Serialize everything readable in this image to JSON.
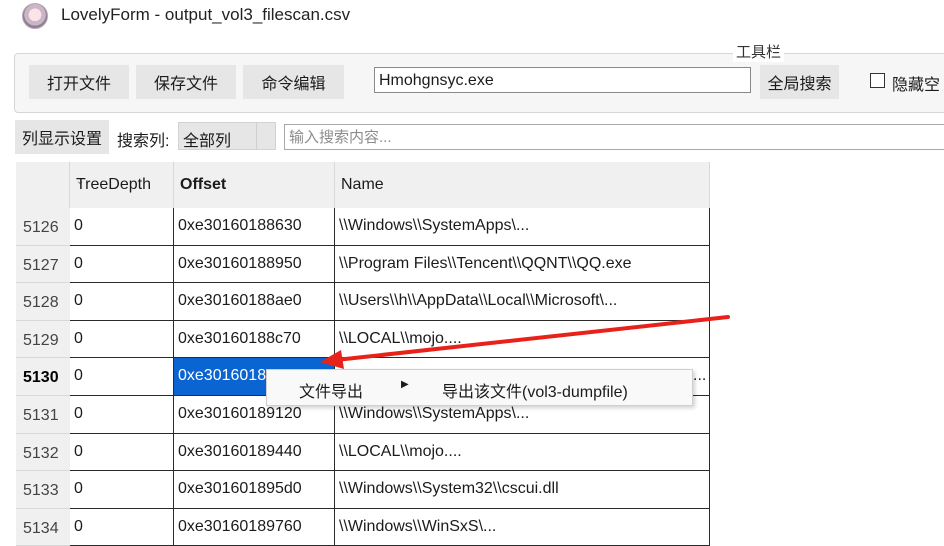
{
  "window": {
    "title": "LovelyForm - output_vol3_filescan.csv"
  },
  "toolbar": {
    "group_label": "工具栏",
    "open_label": "打开文件",
    "save_label": "保存文件",
    "cmd_label": "命令编辑",
    "search_value": "Hmohgnsyc.exe",
    "global_search_label": "全局搜索",
    "hide_label": "隐藏空"
  },
  "filter": {
    "col_settings_label": "列显示设置",
    "search_col_label": "搜索列:",
    "search_col_value": "全部列",
    "placeholder": "输入搜索内容..."
  },
  "table": {
    "columns": [
      "TreeDepth",
      "Offset",
      "Name"
    ],
    "current_row": "5130",
    "rows": [
      {
        "id": "5126",
        "depth": "0",
        "offset": "0xe30160188630",
        "name": "\\\\Windows\\\\SystemApps\\..."
      },
      {
        "id": "5127",
        "depth": "0",
        "offset": "0xe30160188950",
        "name": "\\\\Program Files\\\\Tencent\\\\QQNT\\\\QQ.exe"
      },
      {
        "id": "5128",
        "depth": "0",
        "offset": "0xe30160188ae0",
        "name": "\\\\Users\\\\h\\\\AppData\\\\Local\\\\Microsoft\\..."
      },
      {
        "id": "5129",
        "depth": "0",
        "offset": "0xe30160188c70",
        "name": "\\\\LOCAL\\\\mojo...."
      },
      {
        "id": "5130",
        "depth": "0",
        "offset": "0xe3016018",
        "name": "..."
      },
      {
        "id": "5131",
        "depth": "0",
        "offset": "0xe30160189120",
        "name": "\\\\Windows\\\\SystemApps\\..."
      },
      {
        "id": "5132",
        "depth": "0",
        "offset": "0xe30160189440",
        "name": "\\\\LOCAL\\\\mojo...."
      },
      {
        "id": "5133",
        "depth": "0",
        "offset": "0xe301601895d0",
        "name": "\\\\Windows\\\\System32\\\\cscui.dll"
      },
      {
        "id": "5134",
        "depth": "0",
        "offset": "0xe30160189760",
        "name": "\\\\Windows\\\\WinSxS\\..."
      }
    ]
  },
  "context_menu": {
    "item_label": "文件导出",
    "submenu_label": "导出该文件(vol3-dumpfile)"
  },
  "colors": {
    "selection": "#0a64d2",
    "annotation_arrow": "#e8221a"
  }
}
